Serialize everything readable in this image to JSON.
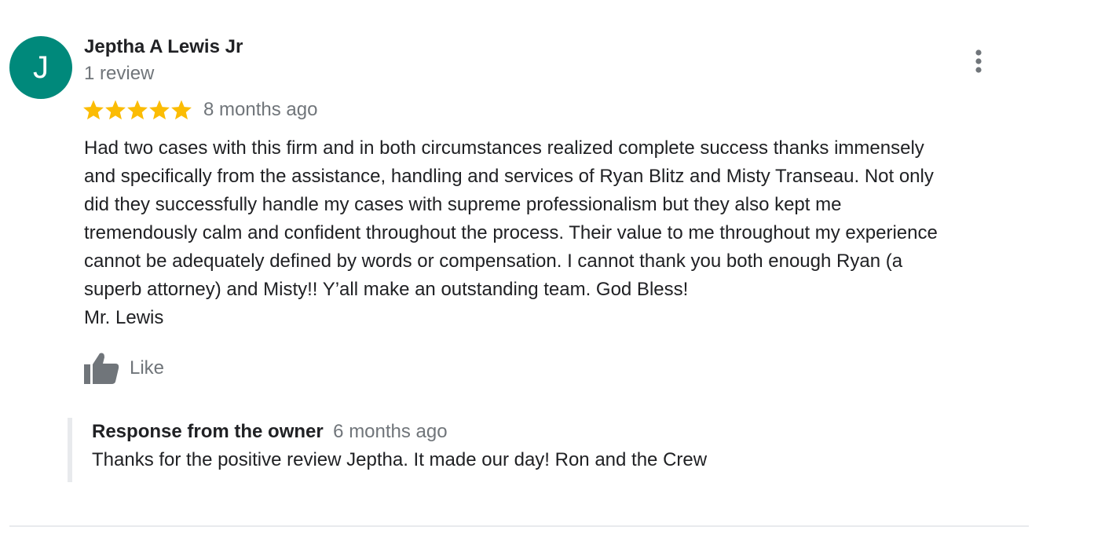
{
  "review": {
    "reviewer_name": "Jeptha A Lewis Jr",
    "avatar_initial": "J",
    "review_count": "1 review",
    "rating": 5,
    "rating_max": 5,
    "date": "8 months ago",
    "text": "Had two cases with this firm and in both circumstances realized complete success thanks immensely\nand specifically from the assistance, handling and services of Ryan Blitz and Misty Transeau. Not only\ndid they successfully handle my cases with supreme professionalism but they also kept me\ntremendously calm and confident throughout the process. Their value to me throughout my experience\ncannot be adequately defined by words or compensation. I cannot thank you both enough Ryan (a\nsuperb attorney) and Misty!! Y’all make an outstanding team. God Bless!\nMr. Lewis",
    "like_label": "Like",
    "more_icon": "more-vert-icon",
    "like_icon": "thumb-up-icon",
    "star_icon": "star-icon"
  },
  "owner_response": {
    "title": "Response from the owner",
    "date": "6 months ago",
    "text": "Thanks for the positive review Jeptha. It made our day! Ron and the Crew"
  },
  "colors": {
    "avatar_bg": "#00897b",
    "star": "#fbbc04",
    "icon_gray": "#70757a",
    "secondary_text": "#70757a",
    "divider": "#e8eaed"
  }
}
